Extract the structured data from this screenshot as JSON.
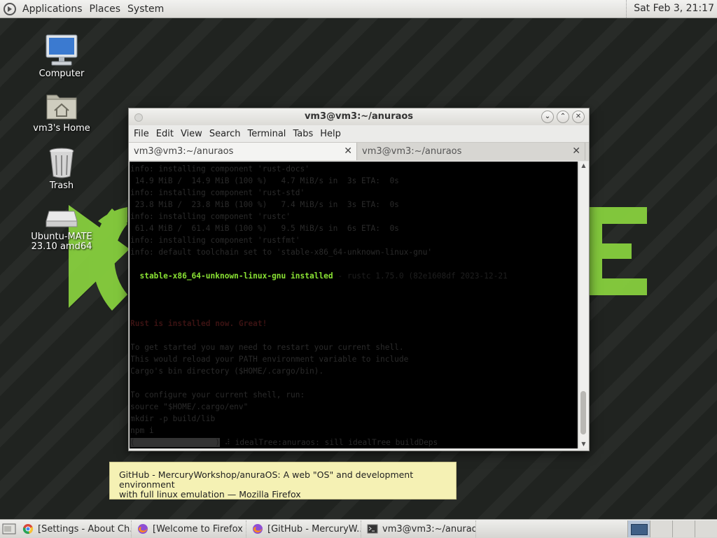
{
  "top_panel": {
    "menus": [
      "Applications",
      "Places",
      "System"
    ],
    "clock": "Sat Feb  3, 21:17"
  },
  "desktop_icons": [
    {
      "label": "Computer",
      "icon": "computer-icon"
    },
    {
      "label": "vm3's Home",
      "icon": "home-folder-icon"
    },
    {
      "label": "Trash",
      "icon": "trash-icon"
    },
    {
      "label": "Ubuntu-MATE 23.10 amd64",
      "icon": "drive-icon"
    }
  ],
  "terminal": {
    "title": "vm3@vm3:~/anuraos",
    "menus": [
      "File",
      "Edit",
      "View",
      "Search",
      "Terminal",
      "Tabs",
      "Help"
    ],
    "tabs": [
      {
        "label": "vm3@vm3:~/anuraos",
        "active": true
      },
      {
        "label": "vm3@vm3:~/anuraos",
        "active": false
      }
    ],
    "lines": [
      "info: installing component 'rust-docs'",
      " 14.9 MiB /  14.9 MiB (100 %)   4.7 MiB/s in  3s ETA:  0s",
      "info: installing component 'rust-std'",
      " 23.8 MiB /  23.8 MiB (100 %)   7.4 MiB/s in  3s ETA:  0s",
      "info: installing component 'rustc'",
      " 61.4 MiB /  61.4 MiB (100 %)   9.5 MiB/s in  6s ETA:  0s",
      "info: installing component 'rustfmt'",
      "info: default toolchain set to 'stable-x86_64-unknown-linux-gnu'",
      "",
      "  stable-x86_64-unknown-linux-gnu installed - rustc 1.75.0 (82e1608df 2023-12-21",
      "",
      "",
      "",
      "Rust is installed now. Great!",
      "",
      "To get started you may need to restart your current shell.",
      "This would reload your PATH environment variable to include",
      "Cargo's bin directory ($HOME/.cargo/bin).",
      "",
      "To configure your current shell, run:",
      "source \"$HOME/.cargo/env\"",
      "mkdir -p build/lib",
      "npm i",
      "(                 ) ⠼ idealTree:anuraos: sill idealTree buildDeps"
    ],
    "green_line": "  stable-x86_64-unknown-linux-gnu installed",
    "green_suffix": " - rustc 1.75.0 (82e1608df 2023-12-21"
  },
  "tooltip": {
    "text_line1": "GitHub - MercuryWorkshop/anuraOS: A web \"OS\" and development environment",
    "text_line2": "with full linux emulation — Mozilla Firefox"
  },
  "taskbar": {
    "tasks": [
      {
        "label": "[Settings - About Ch...",
        "icon": "chrome-icon"
      },
      {
        "label": "[Welcome to Firefox ...",
        "icon": "firefox-icon"
      },
      {
        "label": "[GitHub - MercuryW...",
        "icon": "firefox-icon"
      },
      {
        "label": "vm3@vm3:~/anuraos",
        "icon": "terminal-icon"
      }
    ],
    "workspaces": 4
  },
  "colors": {
    "mate_green": "#87cf3e",
    "terminal_bg": "#000000",
    "tooltip_bg": "#f5f1b4"
  }
}
